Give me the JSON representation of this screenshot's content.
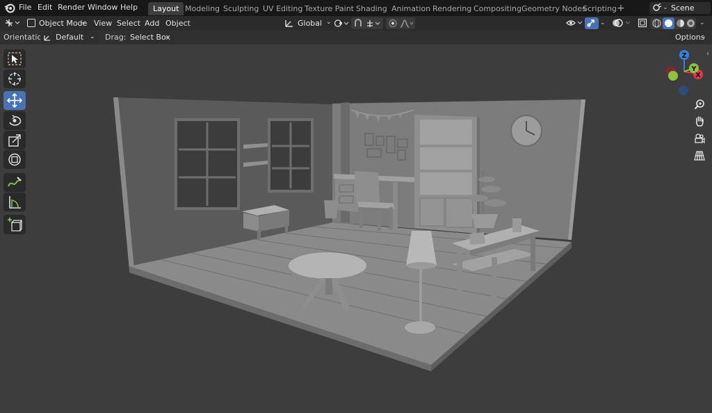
{
  "menu": {
    "file": "File",
    "edit": "Edit",
    "render": "Render",
    "window": "Window",
    "help": "Help"
  },
  "workspaces": [
    "Layout",
    "Modeling",
    "Sculpting",
    "UV Editing",
    "Texture Paint",
    "Shading",
    "Animation",
    "Rendering",
    "Compositing",
    "Geometry Nodes",
    "Scripting"
  ],
  "active_workspace": "Layout",
  "add_workspace": "+",
  "scene": {
    "name": "Scene"
  },
  "header": {
    "mode": "Object Mode",
    "view": "View",
    "select": "Select",
    "add": "Add",
    "object": "Object",
    "transform_orientation": "Global"
  },
  "tool_settings": {
    "orientation_label": "Orientation:",
    "orientation_value": "Default",
    "drag_label": "Drag:",
    "drag_value": "Select Box",
    "options": "Options"
  },
  "gizmo": {
    "x": "X",
    "y": "Y",
    "z": "Z"
  },
  "colors": {
    "x_axis": "#e8364f",
    "y_axis": "#8cc43a",
    "z_axis": "#2f83e4",
    "active": "#4772b3"
  },
  "toolbar": [
    "select-box-icon",
    "cursor-icon",
    "move-icon",
    "rotate-icon",
    "scale-icon",
    "transform-icon",
    "annotate-icon",
    "measure-icon",
    "add-cube-icon"
  ],
  "nav_buttons": [
    "zoom-icon",
    "hand-icon",
    "camera-icon",
    "grid-icon"
  ]
}
